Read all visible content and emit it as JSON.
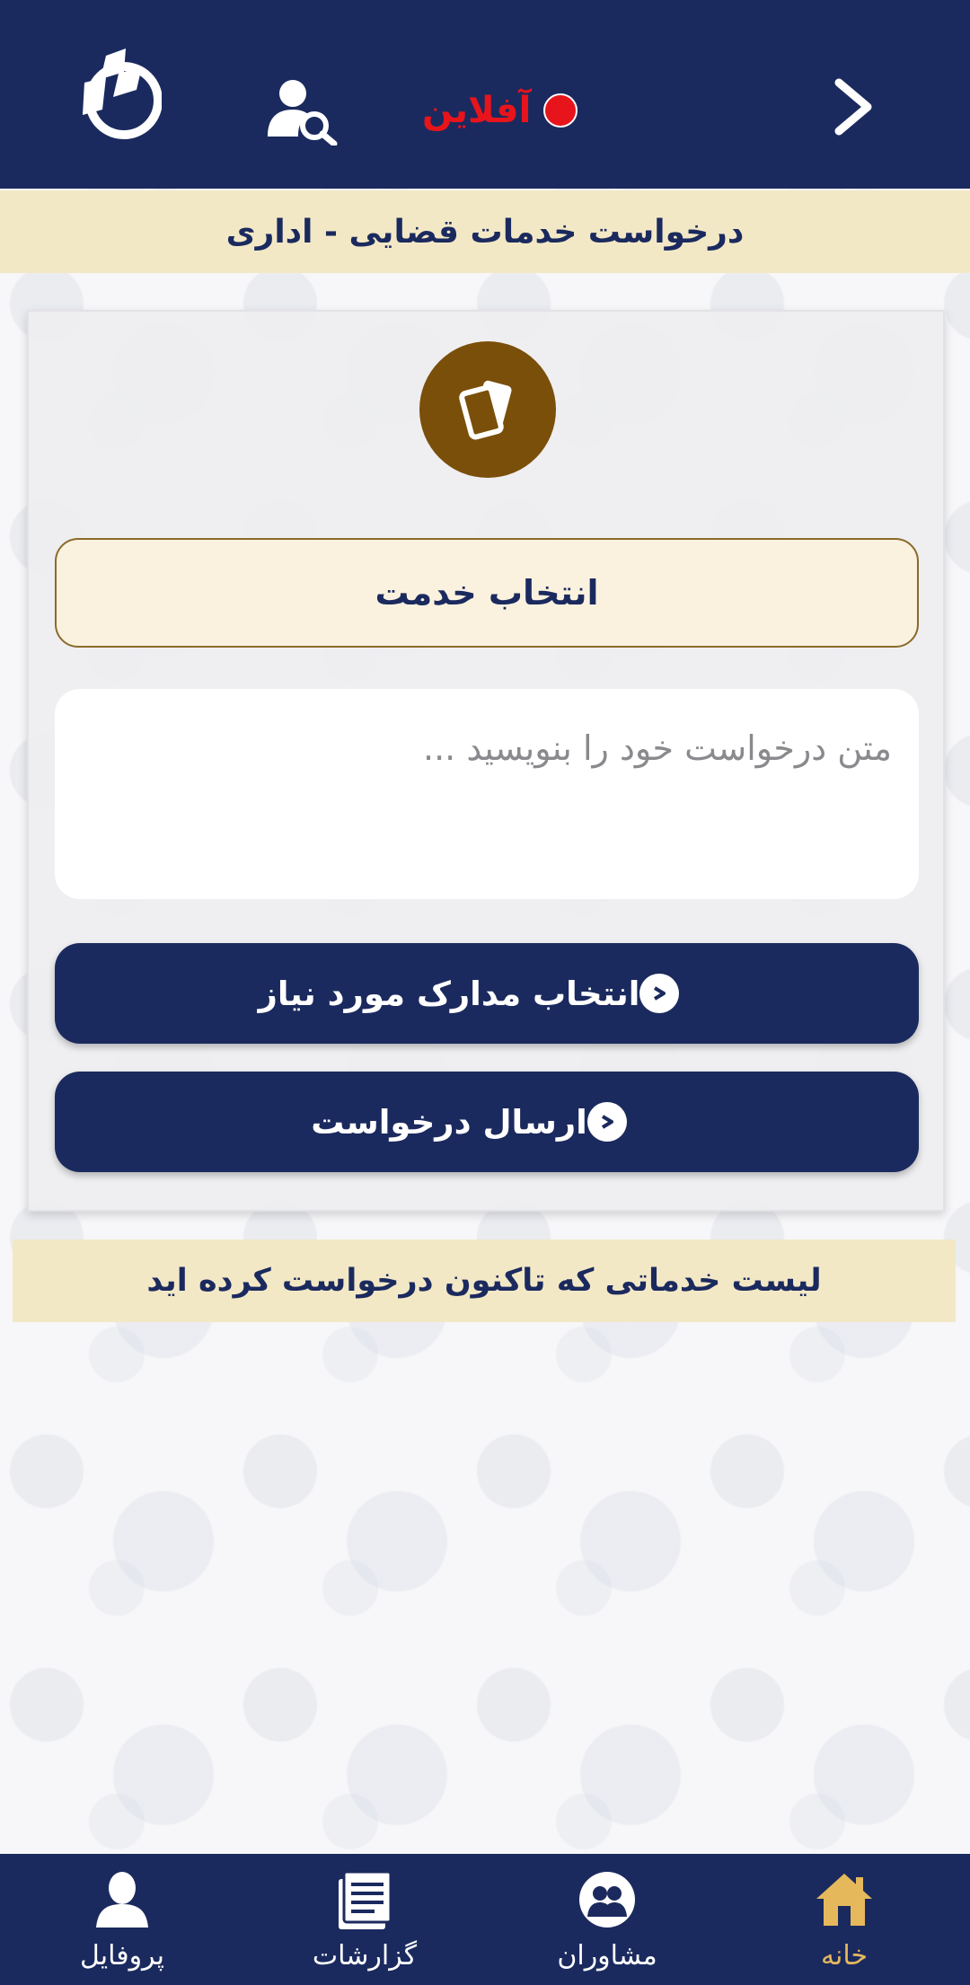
{
  "header": {
    "status_text": "آفلاین",
    "status_color": "#e8141c",
    "background": "#1b2a5e",
    "icons": [
      "logo-icon",
      "user-search-icon",
      "status-dot-icon",
      "chevron-right-icon"
    ]
  },
  "page_title": "درخواست خدمات قضایی - اداری",
  "card": {
    "icon": "cards-icon",
    "icon_color": "#7a4f0a",
    "select_service_label": "انتخاب خدمت",
    "request_placeholder": "متن درخواست خود را بنویسید ...",
    "request_value": "",
    "select_documents_label": "انتخاب مدارک مورد نیاز",
    "send_request_label": "ارسال درخواست"
  },
  "list_title": "لیست خدماتی که تاکنون درخواست کرده اید",
  "bottom_nav": {
    "items": [
      {
        "label": "خانه",
        "icon": "home-icon",
        "active": true
      },
      {
        "label": "مشاوران",
        "icon": "advisors-icon",
        "active": false
      },
      {
        "label": "گزارشات",
        "icon": "reports-icon",
        "active": false
      },
      {
        "label": "پروفایل",
        "icon": "profile-icon",
        "active": false
      }
    ],
    "active_color": "#e6b85c"
  },
  "colors": {
    "primary": "#1b2a5e",
    "banner": "#f3e8c6",
    "accent_gold": "#e6b85c"
  }
}
